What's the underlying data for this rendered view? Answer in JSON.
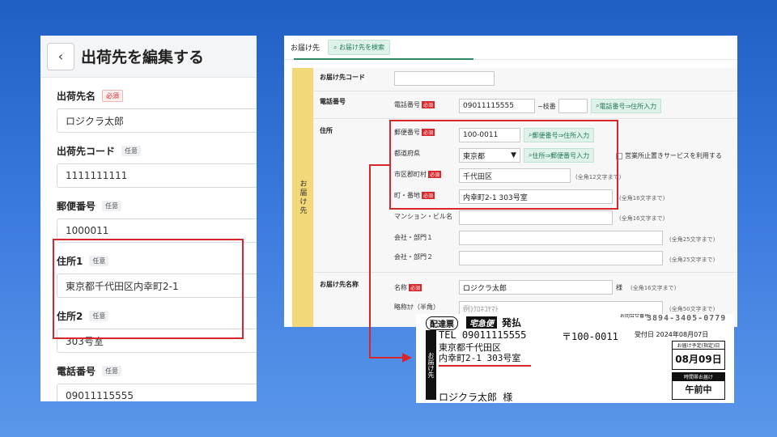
{
  "left": {
    "back_icon": "‹",
    "title": "出荷先を編集する",
    "badge_required": "必須",
    "badge_optional": "任意",
    "fields": [
      {
        "label": "出荷先名",
        "badge": "必須",
        "value": "ロジクラ太郎"
      },
      {
        "label": "出荷先コード",
        "badge": "任意",
        "value": "1111111111"
      },
      {
        "label": "郵便番号",
        "badge": "任意",
        "value": "1000011"
      },
      {
        "label": "住所1",
        "badge": "任意",
        "value": "東京都千代田区内幸町2-1"
      },
      {
        "label": "住所2",
        "badge": "任意",
        "value": "303号室"
      },
      {
        "label": "電話番号",
        "badge": "任意",
        "value": "09011115555"
      }
    ]
  },
  "right": {
    "tab_label": "お届け先",
    "search_button": "お届け先を検索",
    "side_label": "お届け先",
    "row_code": "お届け先コード",
    "row_phone": "電話番号",
    "phone_sub": "電話番号",
    "phone_value": "09011115555",
    "ext_label": "−枝番",
    "phone_btn": "電話番号⇒住所入力",
    "row_address": "住所",
    "zip_label": "郵便番号",
    "zip_value": "100-0011",
    "zip_btn": "郵便番号⇒住所入力",
    "pref_label": "都道府県",
    "pref_value": "東京都",
    "pref_btn": "住所⇒郵便番号入力",
    "branch_check": "営業所止置きサービスを利用する",
    "city_label": "市区郡町村",
    "city_value": "千代田区",
    "city_hint": "(全角12文字まで)",
    "town_label": "町・番地",
    "town_value": "内幸町2-1 303号室",
    "town_hint": "(全角16文字まで)",
    "mansion_label": "マンション・ビル名",
    "mansion_hint": "(全角16文字まで)",
    "company1_label": "会社・部門１",
    "company1_hint": "(全角25文字まで)",
    "company2_label": "会社・部門２",
    "company2_hint": "(全角25文字まで)",
    "row_name": "お届け先名称",
    "name_label": "名称",
    "name_value": "ロジクラ太郎",
    "name_suffix": "様",
    "name_hint": "(全角16文字まで)",
    "kana_label": "略称ｶﾅ（半角）",
    "kana_placeholder": "例)ｸﾛﾈｺﾔﾏﾄ",
    "kana_hint": "(全角50文字まで)",
    "required_mini": "必須"
  },
  "label": {
    "head1": "配達票",
    "head2": "宅急便",
    "head3": "発払",
    "top_small": "お問合せ番号",
    "top_number": "3894-3405-0779",
    "tel": "TEL 09011115555",
    "zip": "〒100-0011",
    "receipt": "受付日 2024年08月07日",
    "addr1": "東京都千代田区",
    "addr2": "内幸町2-1 303号室",
    "name": "ロジクラ太郎 様",
    "side": "お届け先",
    "box1_title": "お届け予定(指定)日",
    "box1_value": "08月09日",
    "box2_title": "時間帯お届け",
    "box2_value": "午前中"
  },
  "colors": {
    "highlight": "#d9262c",
    "accent_green": "#2c8a63",
    "side_yellow": "#f3d87a"
  }
}
